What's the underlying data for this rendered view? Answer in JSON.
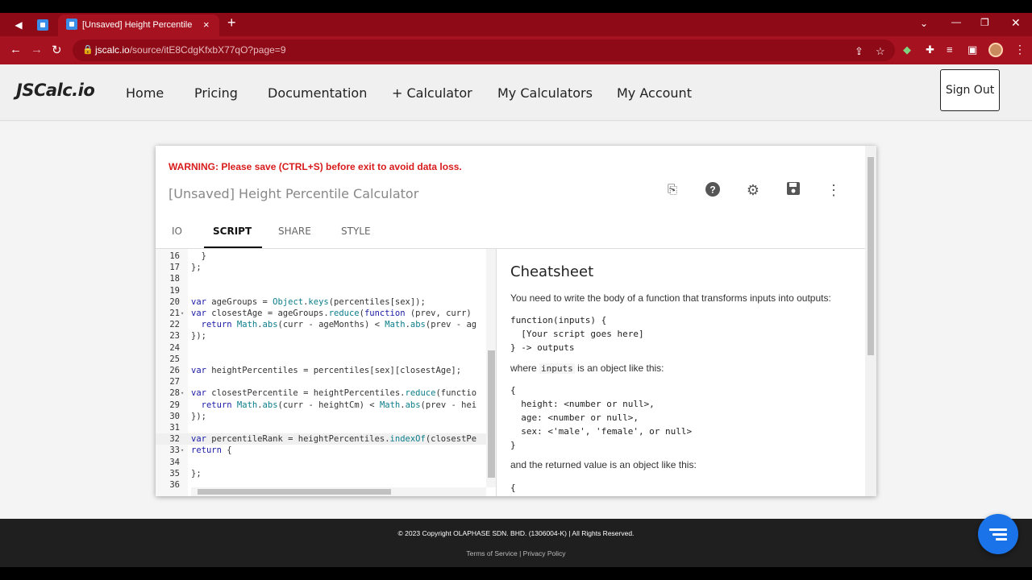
{
  "browser": {
    "tab_title": "[Unsaved] Height Percentile Calc",
    "tab_close": "×",
    "new_tab": "+",
    "url_host": "jscalc.io",
    "url_path": "/source/itE8CdgKfxbX77qO?page=9",
    "icons": [
      "back-arrow-icon",
      "forward-arrow-icon",
      "reload-icon",
      "lock-icon",
      "share-icon",
      "star-icon",
      "extension-icon",
      "puzzle-icon",
      "media-icon",
      "sidebar-icon",
      "profile-avatar",
      "menu-dots-icon"
    ]
  },
  "site": {
    "logo": "JSCalc.io",
    "nav": [
      "Home",
      "Pricing",
      "Documentation",
      "+ Calculator",
      "My Calculators",
      "My Account"
    ],
    "sign_out": "Sign Out"
  },
  "editor": {
    "warning": "WARNING: Please save (CTRL+S) before exit to avoid data loss.",
    "title": "[Unsaved] Height Percentile Calculator",
    "tool_icons": [
      "file-settings-icon",
      "help-icon",
      "settings-icon",
      "save-icon",
      "more-vert-icon"
    ],
    "tabs": [
      "IO",
      "SCRIPT",
      "SHARE",
      "STYLE"
    ],
    "active_tab": "SCRIPT",
    "code_lines": [
      {
        "n": "16",
        "t": "  }"
      },
      {
        "n": "17",
        "t": "};"
      },
      {
        "n": "18",
        "t": ""
      },
      {
        "n": "19",
        "t": ""
      },
      {
        "n": "20",
        "t": "var ageGroups = Object.keys(percentiles[sex]);"
      },
      {
        "n": "21",
        "t": "var closestAge = ageGroups.reduce(function (prev, curr)"
      },
      {
        "n": "22",
        "t": "  return Math.abs(curr - ageMonths) < Math.abs(prev - ag"
      },
      {
        "n": "23",
        "t": "});"
      },
      {
        "n": "24",
        "t": ""
      },
      {
        "n": "25",
        "t": ""
      },
      {
        "n": "26",
        "t": "var heightPercentiles = percentiles[sex][closestAge];"
      },
      {
        "n": "27",
        "t": ""
      },
      {
        "n": "28",
        "t": "var closestPercentile = heightPercentiles.reduce(functio"
      },
      {
        "n": "29",
        "t": "  return Math.abs(curr - heightCm) < Math.abs(prev - hei"
      },
      {
        "n": "30",
        "t": "});"
      },
      {
        "n": "31",
        "t": ""
      },
      {
        "n": "32",
        "t": "var percentileRank = heightPercentiles.indexOf(closestPe"
      },
      {
        "n": "33",
        "t": "return {"
      },
      {
        "n": "34",
        "t": ""
      },
      {
        "n": "35",
        "t": "};"
      },
      {
        "n": "36",
        "t": ""
      }
    ]
  },
  "cheatsheet": {
    "heading": "Cheatsheet",
    "intro": "You need to write the body of a function that transforms inputs into outputs:",
    "signature": "function(inputs) {\n  [Your script goes here]\n} -> outputs",
    "where_prefix": "where ",
    "where_code": "inputs",
    "where_suffix": " is an object like this:",
    "inputs_example": "{\n  height: <number or null>,\n  age: <number or null>,\n  sex: <'male', 'female', or null>\n}",
    "returned": "and the returned value is an object like this:",
    "returned_start": "{"
  },
  "footer": {
    "copyright": "© 2023 Copyright OLAPHASE SDN. BHD. (1306004-K) | All Rights Reserved.",
    "terms": "Terms of Service",
    "separator": " | ",
    "privacy": "Privacy Policy"
  },
  "colors": {
    "browser_frame": "#a6121f",
    "warning": "#d81b1b",
    "fab": "#1a73e8"
  }
}
